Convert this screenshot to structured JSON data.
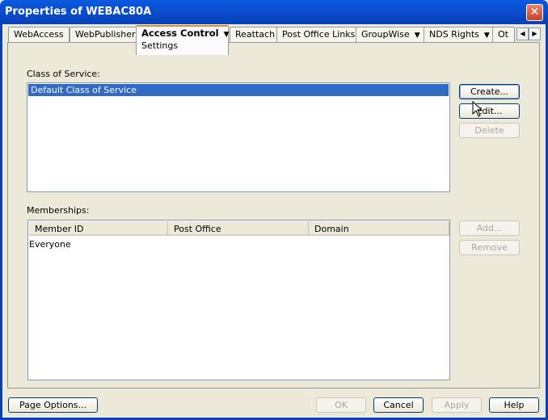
{
  "window": {
    "title": "Properties of WEBAC80A",
    "close_glyph": "✕"
  },
  "tabs": [
    {
      "label": "WebAccess"
    },
    {
      "label": "WebPublisher"
    },
    {
      "label": "Access Control",
      "sub": "Settings",
      "active": true
    },
    {
      "label": "Reattach"
    },
    {
      "label": "Post Office Links"
    },
    {
      "label": "GroupWise"
    },
    {
      "label": "NDS Rights"
    },
    {
      "label": "Ot"
    }
  ],
  "class_of_service": {
    "label": "Class of Service:",
    "items": [
      "Default Class of Service"
    ],
    "buttons": {
      "create": "Create...",
      "edit": "Edit...",
      "delete": "Delete"
    }
  },
  "memberships": {
    "label": "Memberships:",
    "columns": [
      "Member ID",
      "Post Office",
      "Domain"
    ],
    "rows": [
      "Everyone"
    ],
    "buttons": {
      "add": "Add...",
      "remove": "Remove"
    }
  },
  "footer": {
    "page_options": "Page Options...",
    "ok": "OK",
    "cancel": "Cancel",
    "apply": "Apply",
    "help": "Help"
  },
  "colors": {
    "titlebar": "#0a4ed0",
    "selection": "#316ac5",
    "dialog_bg": "#ece9d8",
    "active_tab_accent": "#e68b2c"
  }
}
